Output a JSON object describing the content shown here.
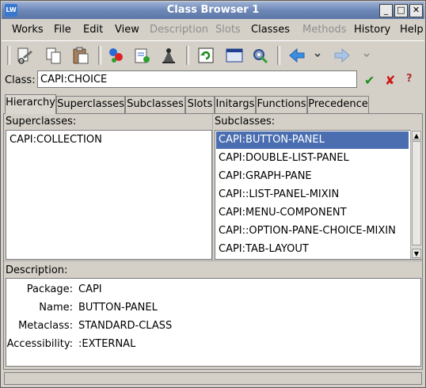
{
  "window": {
    "title": "Class Browser 1",
    "app_icon": "LW",
    "controls": {
      "minimize": "_",
      "maximize": "□",
      "close": "✕"
    }
  },
  "menu": [
    {
      "label": "Works",
      "enabled": true
    },
    {
      "label": "File",
      "enabled": true
    },
    {
      "label": "Edit",
      "enabled": true
    },
    {
      "label": "View",
      "enabled": true
    },
    {
      "label": "Description",
      "enabled": false
    },
    {
      "label": "Slots",
      "enabled": false
    },
    {
      "label": "Classes",
      "enabled": true
    },
    {
      "label": "Methods",
      "enabled": false
    },
    {
      "label": "History",
      "enabled": true
    },
    {
      "label": "Help",
      "enabled": true
    }
  ],
  "toolbar": {
    "icons": [
      "cut-icon",
      "copy-icon",
      "paste-icon",
      "inspect-icon",
      "listener-icon",
      "debug-icon",
      "refresh-icon",
      "window-icon",
      "tools-icon",
      "back-icon",
      "back-menu-icon",
      "forward-icon",
      "forward-menu-icon"
    ]
  },
  "class_field": {
    "label": "Class:",
    "value": "CAPI:CHOICE",
    "ok_glyph": "✔",
    "cancel_glyph": "✘",
    "help_glyph": "?"
  },
  "tabs": [
    {
      "label": "Hierarchy",
      "active": true
    },
    {
      "label": "Superclasses",
      "active": false
    },
    {
      "label": "Subclasses",
      "active": false
    },
    {
      "label": "Slots",
      "active": false
    },
    {
      "label": "Initargs",
      "active": false
    },
    {
      "label": "Functions",
      "active": false
    },
    {
      "label": "Precedence",
      "active": false
    }
  ],
  "superclasses": {
    "label": "Superclasses:",
    "items": [
      "CAPI:COLLECTION"
    ]
  },
  "subclasses": {
    "label": "Subclasses:",
    "items": [
      "CAPI:BUTTON-PANEL",
      "CAPI:DOUBLE-LIST-PANEL",
      "CAPI:GRAPH-PANE",
      "CAPI::LIST-PANEL-MIXIN",
      "CAPI:MENU-COMPONENT",
      "CAPI::OPTION-PANE-CHOICE-MIXIN",
      "CAPI:TAB-LAYOUT"
    ],
    "selected_index": 0
  },
  "description": {
    "label": "Description:",
    "rows": [
      {
        "key": "Package:",
        "value": "CAPI"
      },
      {
        "key": "Name:",
        "value": "BUTTON-PANEL"
      },
      {
        "key": "Metaclass:",
        "value": "STANDARD-CLASS"
      },
      {
        "key": "Accessibility:",
        "value": ":EXTERNAL"
      }
    ]
  },
  "colors": {
    "titlebar": "#6d87b6",
    "selection": "#4a6eb0",
    "ok": "#1f8f1f",
    "cancel": "#d01818"
  }
}
